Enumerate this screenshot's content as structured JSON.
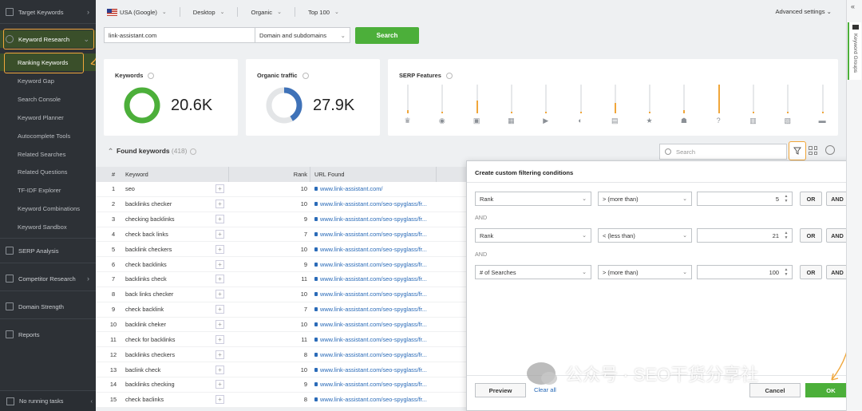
{
  "sidebar": {
    "items": [
      {
        "label": "Target Keywords",
        "chevron": "›"
      },
      {
        "label": "Keyword Research",
        "chevron": "⌄"
      },
      {
        "label": "Ranking Keywords"
      },
      {
        "label": "Keyword Gap"
      },
      {
        "label": "Search Console"
      },
      {
        "label": "Keyword Planner"
      },
      {
        "label": "Autocomplete Tools"
      },
      {
        "label": "Related Searches"
      },
      {
        "label": "Related Questions"
      },
      {
        "label": "TF-IDF Explorer"
      },
      {
        "label": "Keyword Combinations"
      },
      {
        "label": "Keyword Sandbox"
      },
      {
        "label": "SERP Analysis"
      },
      {
        "label": "Competitor Research",
        "chevron": "›"
      },
      {
        "label": "Domain Strength"
      },
      {
        "label": "Reports"
      }
    ],
    "status": "No running tasks",
    "collapse": "‹",
    "accent": "#f0a63a"
  },
  "topbar": {
    "country": "USA (Google)",
    "device": "Desktop",
    "type": "Organic",
    "top": "Top 100",
    "advanced": "Advanced settings ⌄"
  },
  "query": {
    "url": "link-assistant.com",
    "scope": "Domain and subdomains",
    "search_label": "Search"
  },
  "cards": {
    "keywords": {
      "title": "Keywords",
      "value": "20.6K"
    },
    "traffic": {
      "title": "Organic traffic",
      "value": "27.9K"
    },
    "serp": {
      "title": "SERP Features",
      "levels": [
        0.1,
        0.05,
        0.45,
        0.0,
        0.0,
        0.05,
        0.35,
        0.0,
        0.1,
        1.0,
        0.0,
        0.05,
        0.0
      ],
      "icons": [
        "♛",
        "◉",
        "▣",
        "▦",
        "▶",
        "◐",
        "▤",
        "★",
        "☗",
        "?",
        "▥",
        "▧",
        "▬"
      ]
    }
  },
  "table": {
    "found_label": "Found keywords",
    "found_count": "(418)",
    "search_placeholder": "Search",
    "headers": {
      "num": "#",
      "keyword": "Keyword",
      "rank": "Rank",
      "url": "URL Found"
    },
    "rows": [
      {
        "n": "1",
        "kw": "seo",
        "rank": "10",
        "url": "www.link-assistant.com/"
      },
      {
        "n": "2",
        "kw": "backlinks checker",
        "rank": "10",
        "url": "www.link-assistant.com/seo-spyglass/fr..."
      },
      {
        "n": "3",
        "kw": "checking backlinks",
        "rank": "9",
        "url": "www.link-assistant.com/seo-spyglass/fr..."
      },
      {
        "n": "4",
        "kw": "check back links",
        "rank": "7",
        "url": "www.link-assistant.com/seo-spyglass/fr..."
      },
      {
        "n": "5",
        "kw": "backlink checkers",
        "rank": "10",
        "url": "www.link-assistant.com/seo-spyglass/fr..."
      },
      {
        "n": "6",
        "kw": "check backlinks",
        "rank": "9",
        "url": "www.link-assistant.com/seo-spyglass/fr..."
      },
      {
        "n": "7",
        "kw": "backlinks check",
        "rank": "11",
        "url": "www.link-assistant.com/seo-spyglass/fr..."
      },
      {
        "n": "8",
        "kw": "back links checker",
        "rank": "10",
        "url": "www.link-assistant.com/seo-spyglass/fr..."
      },
      {
        "n": "9",
        "kw": "check backlink",
        "rank": "7",
        "url": "www.link-assistant.com/seo-spyglass/fr..."
      },
      {
        "n": "10",
        "kw": "backlink cheker",
        "rank": "10",
        "url": "www.link-assistant.com/seo-spyglass/fr..."
      },
      {
        "n": "11",
        "kw": "check for backlinks",
        "rank": "11",
        "url": "www.link-assistant.com/seo-spyglass/fr..."
      },
      {
        "n": "12",
        "kw": "backlinks checkers",
        "rank": "8",
        "url": "www.link-assistant.com/seo-spyglass/fr..."
      },
      {
        "n": "13",
        "kw": "baclink check",
        "rank": "10",
        "url": "www.link-assistant.com/seo-spyglass/fr..."
      },
      {
        "n": "14",
        "kw": "backlinks checking",
        "rank": "9",
        "url": "www.link-assistant.com/seo-spyglass/fr..."
      },
      {
        "n": "15",
        "kw": "check baclinks",
        "rank": "8",
        "url": "www.link-assistant.com/seo-spyglass/fr..."
      }
    ]
  },
  "dialog": {
    "title": "Create custom filtering conditions",
    "close": "✕",
    "and_label": "AND",
    "conditions": [
      {
        "field": "Rank",
        "op": "> (more than)",
        "value": "5"
      },
      {
        "field": "Rank",
        "op": "< (less than)",
        "value": "21"
      },
      {
        "field": "# of Searches",
        "op": "> (more than)",
        "value": "100"
      }
    ],
    "or_label": "OR",
    "and_btn": "AND",
    "preview": "Preview",
    "clear": "Clear all",
    "cancel": "Cancel",
    "ok": "OK"
  },
  "rail": {
    "tab_label": "Keyword Groups",
    "collapse": "«"
  },
  "watermark": "公众号 · SEO干货分享社",
  "colors": {
    "green": "#4caf3a",
    "blue": "#3f72b8",
    "orange": "#f0a63a",
    "sidebar": "#2d3136"
  }
}
